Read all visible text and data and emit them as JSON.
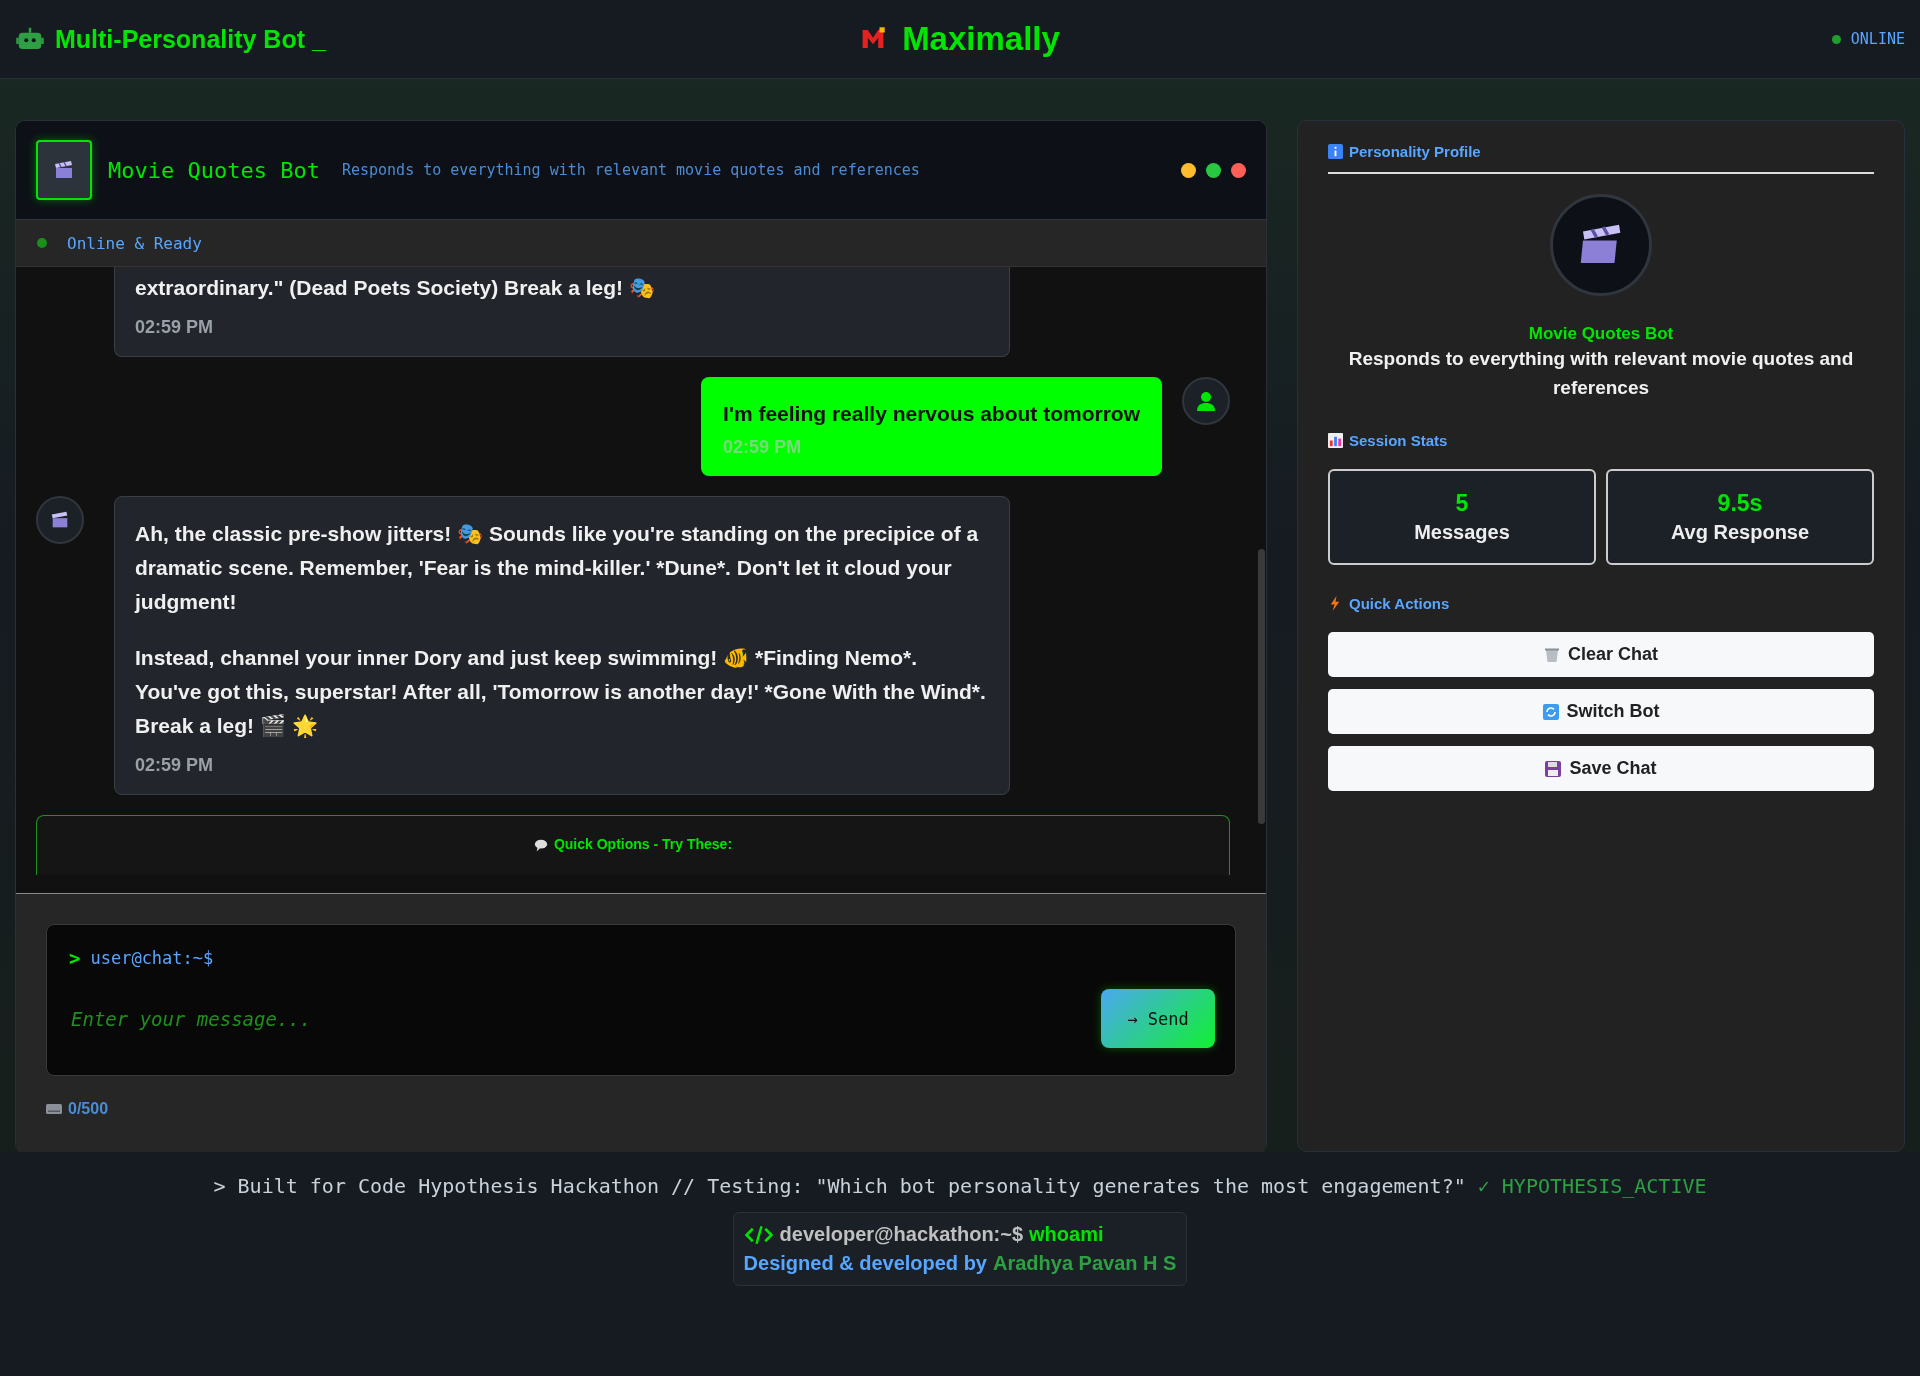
{
  "header": {
    "title": "Multi-Personality Bot _",
    "brand": "Maximally",
    "status": "ONLINE"
  },
  "chat": {
    "bot_name": "Movie Quotes Bot",
    "bot_description": "Responds to everything with relevant movie quotes and references",
    "window_dots": [
      {
        "color": "#febc2e"
      },
      {
        "color": "#28c840"
      },
      {
        "color": "#ff5f57"
      }
    ],
    "status": "Online & Ready",
    "messages": [
      {
        "kind": "continuation",
        "paragraphs": [
          "extraordinary.\" (Dead Poets Society) Break a leg! 🎭"
        ],
        "time": "02:59 PM"
      },
      {
        "kind": "user",
        "paragraphs": [
          "I'm feeling really nervous about tomorrow"
        ],
        "time": "02:59 PM"
      },
      {
        "kind": "bot",
        "paragraphs": [
          "Ah, the classic pre-show jitters! 🎭 Sounds like you're standing on the precipice of a dramatic scene. Remember, 'Fear is the mind-killer.' *Dune*. Don't let it cloud your judgment!",
          "Instead, channel your inner Dory and just keep swimming! 🐠 *Finding Nemo*. You've got this, superstar! After all, 'Tomorrow is another day!' *Gone With the Wind*. Break a leg! 🎬 🌟"
        ],
        "time": "02:59 PM"
      }
    ],
    "quick_options_title": "Quick Options - Try These:",
    "prompt_symbol": ">",
    "prompt": "user@chat:~$",
    "placeholder": "Enter your message...",
    "send_label": "→ Send",
    "char_count": "0/500"
  },
  "sidebar": {
    "profile_title": "Personality Profile",
    "bot_name": "Movie Quotes Bot",
    "bot_description": "Responds to everything with relevant movie quotes and references",
    "stats_title": "Session Stats",
    "stats": [
      {
        "value": "5",
        "label": "Messages"
      },
      {
        "value": "9.5s",
        "label": "Avg Response"
      }
    ],
    "actions_title": "Quick Actions",
    "actions": [
      {
        "kind": "trash",
        "label": "Clear Chat"
      },
      {
        "kind": "switch",
        "label": "Switch Bot"
      },
      {
        "kind": "save",
        "label": "Save Chat"
      }
    ]
  },
  "footer": {
    "line": "> Built for Code Hypothesis Hackathon // Testing: \"Which bot personality generates the most engagement?\"",
    "badge": "✓ HYPOTHESIS_ACTIVE",
    "prompt": "developer@hackathon:~$",
    "command": "whoami",
    "credit": "Designed & developed by",
    "author": "Aradhya Pavan H S"
  }
}
